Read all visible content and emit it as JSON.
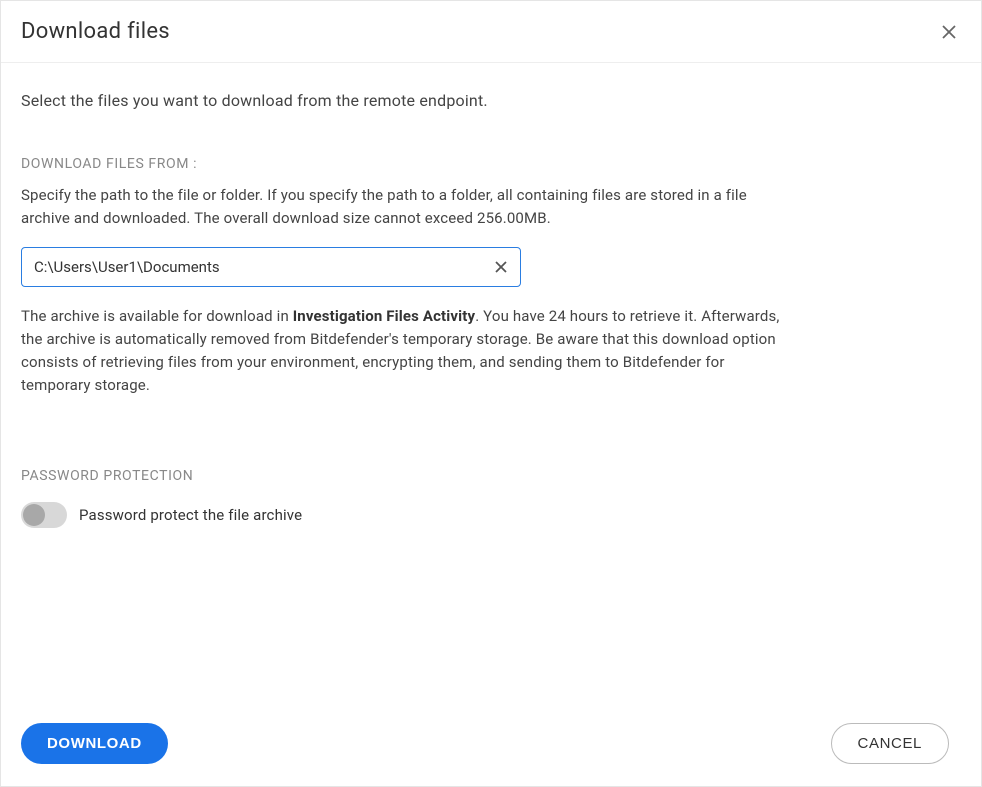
{
  "modal": {
    "title": "Download files"
  },
  "body": {
    "intro": "Select the files you want to download from the remote endpoint.",
    "section_from_label": "DOWNLOAD FILES FROM :",
    "path_help": "Specify the path to the file or folder. If you specify the path to a folder, all containing files are stored in a file archive and downloaded. The overall download size cannot exceed 256.00MB.",
    "path_value": "C:\\Users\\User1\\Documents",
    "archive_note_prefix": "The archive is available for download in ",
    "archive_note_bold": "Investigation Files Activity",
    "archive_note_suffix": ". You have 24 hours to retrieve it. Afterwards, the archive is automatically removed from Bitdefender's temporary storage. Be aware that this download option consists of retrieving files from your environment, encrypting them, and sending them to Bitdefender for temporary storage."
  },
  "password": {
    "section_label": "PASSWORD PROTECTION",
    "toggle_label": "Password protect the file archive",
    "enabled": false
  },
  "footer": {
    "download_label": "DOWNLOAD",
    "cancel_label": "CANCEL"
  }
}
